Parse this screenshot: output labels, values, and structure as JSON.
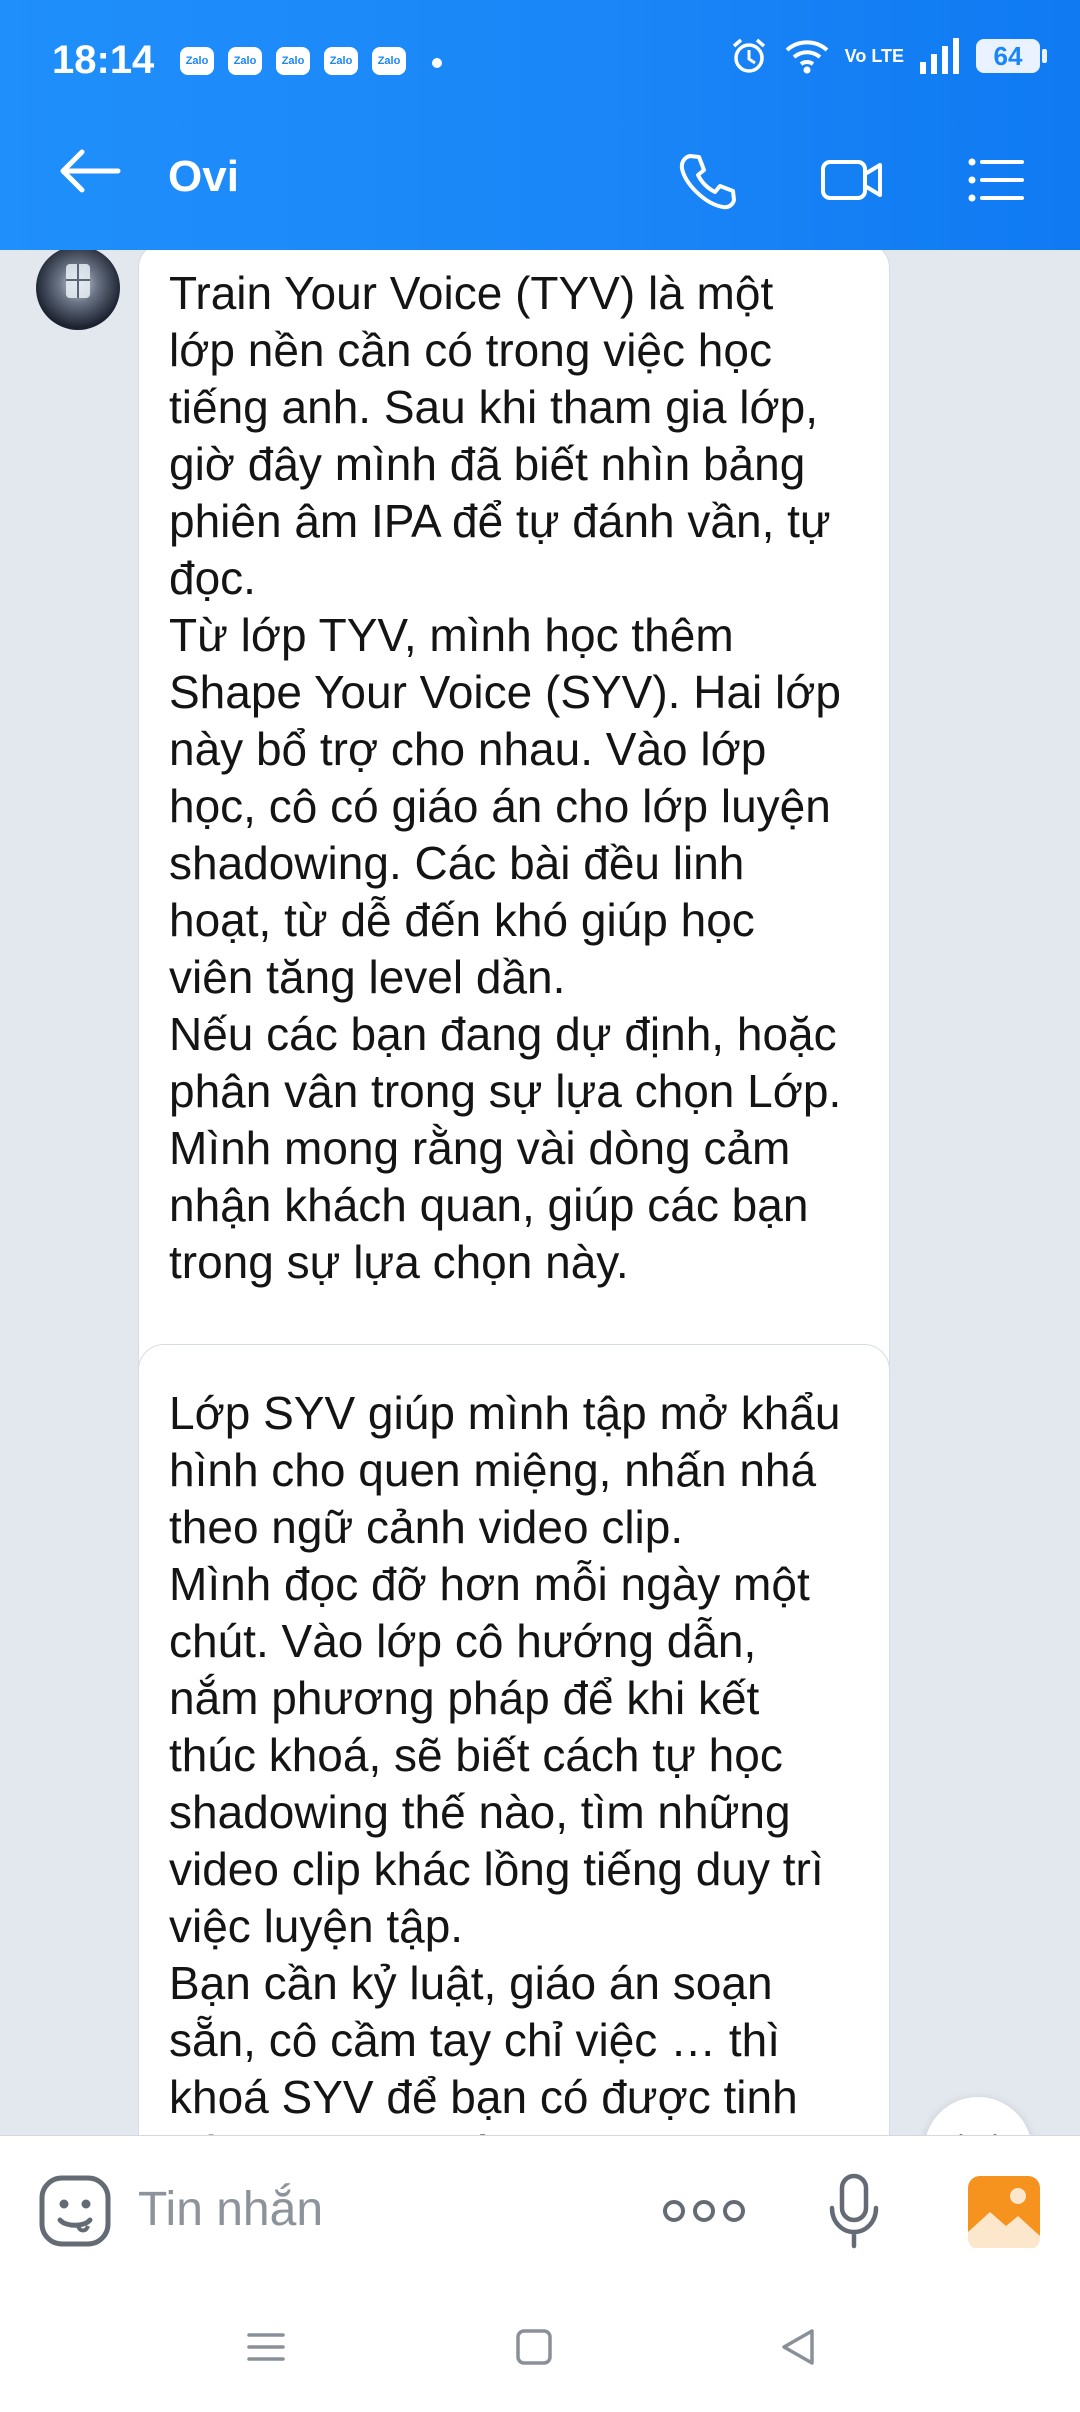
{
  "status": {
    "time": "18:14",
    "notifications": [
      "Zalo",
      "Zalo",
      "Zalo",
      "Zalo",
      "Zalo"
    ],
    "network": "Vo LTE",
    "battery": "64"
  },
  "header": {
    "title": "Ovi",
    "icons": [
      "back-arrow-icon",
      "phone-icon",
      "video-call-icon",
      "menu-list-icon"
    ],
    "color": "#1a86f7"
  },
  "messages": [
    {
      "text": "Train Your Voice (TYV) là một\nlớp nền cần có trong việc học\ntiếng anh. Sau khi tham gia lớp,\ngiờ đây mình đã biết nhìn bảng\nphiên âm IPA để tự đánh vần, tự\nđọc.\nTừ lớp TYV, mình học thêm\nShape Your Voice (SYV). Hai lớp\nnày bổ trợ cho nhau. Vào lớp\nhọc, cô có giáo án cho lớp luyện\nshadowing. Các bài đều linh\nhoạt, từ dễ đến khó giúp học\nviên tăng level dần.\nNếu các bạn đang dự định, hoặc\nphân vân trong sự lựa chọn Lớp.\nMình mong rằng vài dòng cảm\nnhận khách quan, giúp các bạn\ntrong sự lựa chọn này."
    },
    {
      "text": "Lớp SYV giúp mình tập mở khẩu\nhình cho quen miệng, nhấn nhá\ntheo ngữ cảnh video clip.\nMình đọc đỡ hơn mỗi ngày một\nchút. Vào lớp cô hướng dẫn,\nnắm phương pháp để khi kết\nthúc khoá, sẽ biết cách tự học\nshadowing thế nào, tìm những\nvideo clip khác lồng tiếng duy trì\nviệc luyện tập.\nBạn cần kỷ luật, giáo án soạn\nsẵn, cô cầm tay chỉ việc … thì\nkhoá SYV để bạn có được tinh\nthần đó. Một số trò chuyện"
    }
  ],
  "composer": {
    "placeholder": "Tin nhắn",
    "icons": [
      "sticker-icon",
      "more-icon",
      "microphone-icon",
      "image-gallery-icon"
    ]
  },
  "navigation": {
    "icons": [
      "recent-apps-icon",
      "home-icon",
      "back-icon"
    ]
  }
}
